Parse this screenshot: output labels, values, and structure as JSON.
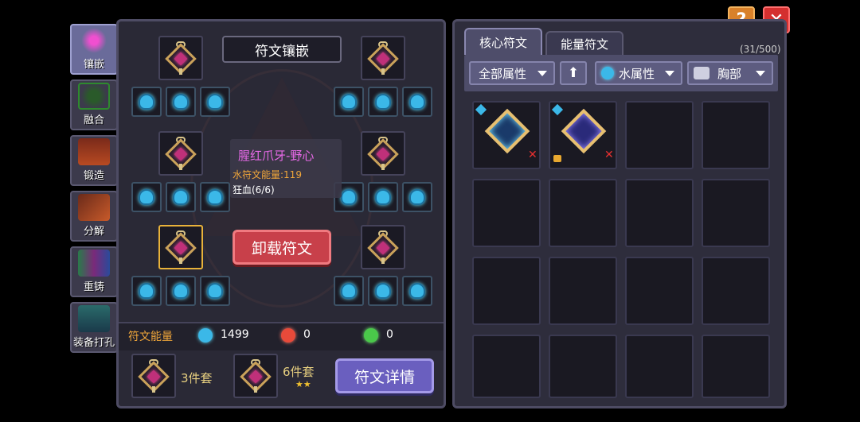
{
  "side_tabs": [
    {
      "label": "镶嵌",
      "icon": "socket-icon",
      "active": true
    },
    {
      "label": "融合",
      "icon": "fusion-icon",
      "active": false
    },
    {
      "label": "锻造",
      "icon": "forge-icon",
      "active": false
    },
    {
      "label": "分解",
      "icon": "decompose-icon",
      "active": false
    },
    {
      "label": "重铸",
      "icon": "recast-icon",
      "active": false
    },
    {
      "label": "装备打孔",
      "icon": "punch-icon",
      "active": false
    }
  ],
  "rune_panel": {
    "title": "符文镶嵌",
    "rune_name": "腥红爪牙-野心",
    "energy_line": "水符文能量:119",
    "bonus_line": "狂血(6/6)",
    "unload_button": "卸载符文"
  },
  "energy_bar": {
    "label": "符文能量",
    "water": "1499",
    "fire": "0",
    "nature": "0"
  },
  "sets": [
    {
      "label": "3件套",
      "stars": ""
    },
    {
      "label": "6件套",
      "stars": "★★"
    }
  ],
  "details_button": "符文详情",
  "inventory": {
    "tabs": [
      "核心符文",
      "能量符文"
    ],
    "active_tab": 0,
    "count": "(31/500)",
    "filters": {
      "attribute": "全部属性",
      "element": "水属性",
      "slot": "胸部"
    }
  },
  "header_buttons": {
    "help": "?",
    "close": "✕"
  },
  "colors": {
    "accent_gold": "#e8b23a",
    "red_button": "#c8404a",
    "purple_button": "#6a5fbf",
    "water_blue": "#3bb8e8"
  }
}
